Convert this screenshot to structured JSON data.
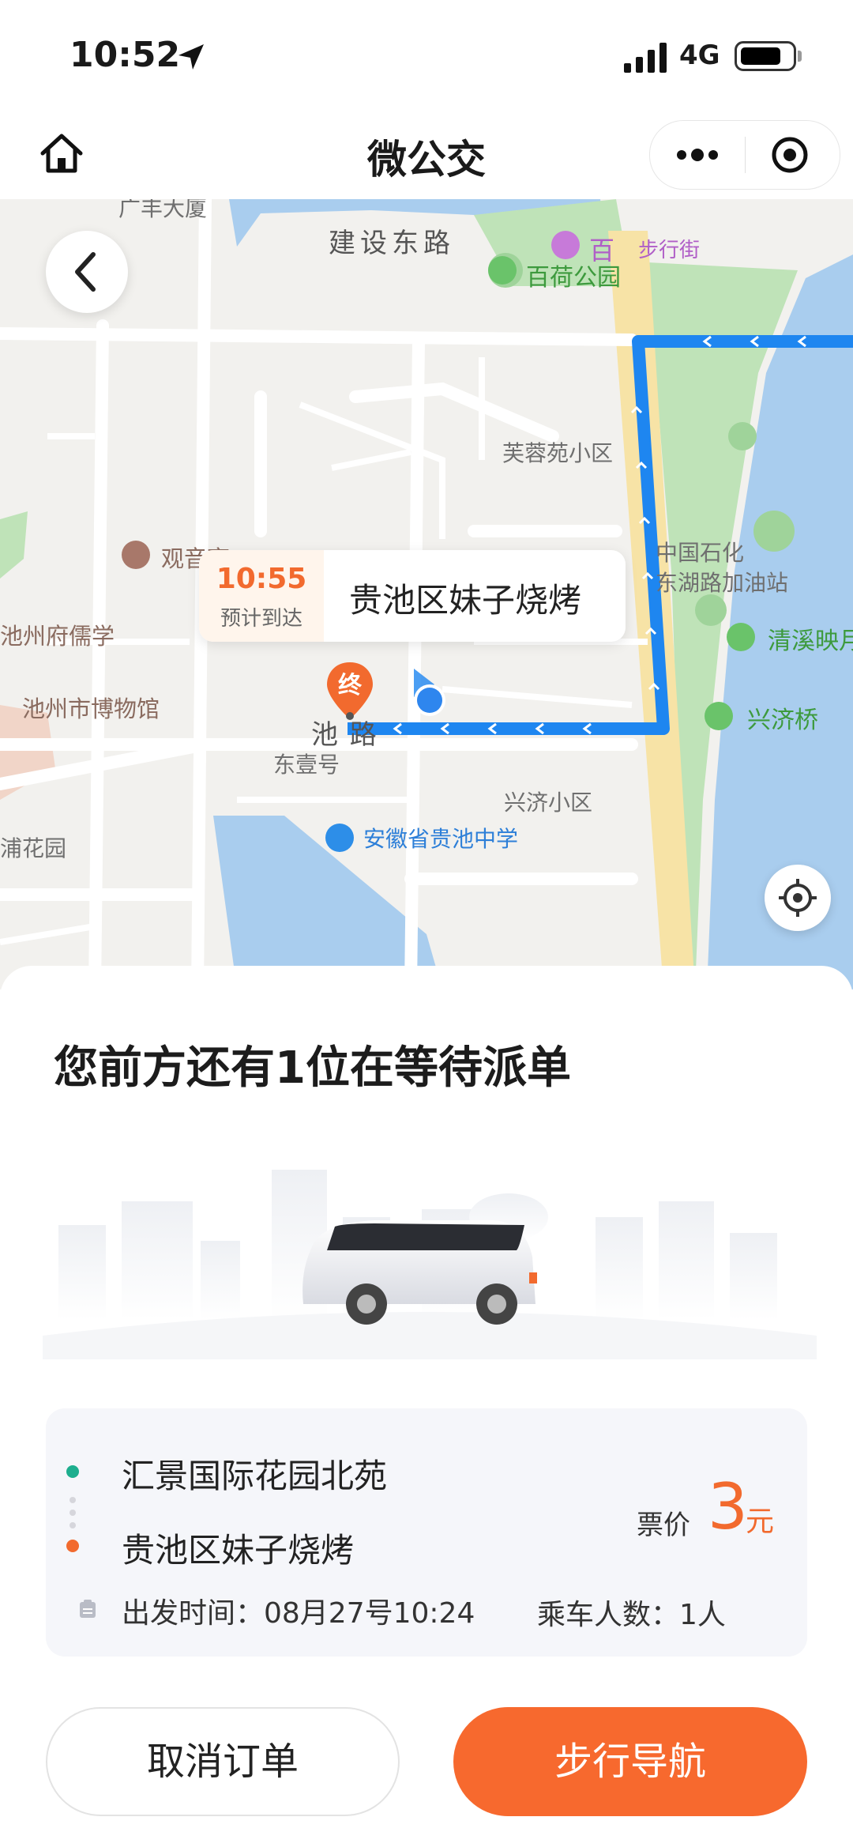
{
  "status_bar": {
    "time": "10:52",
    "network": "4G"
  },
  "header": {
    "title": "微公交"
  },
  "map": {
    "labels": {
      "guangfeng": "广丰大厦",
      "baihe_park": "百荷公园",
      "jianshe_east": "建设东路",
      "bai": "百",
      "walking_street": "步行街",
      "furongyuan": "芙蓉苑小区",
      "guanyin": "观音亭",
      "sinopec": "中国石化",
      "donghu_gas": "东湖路加油站",
      "qingxi": "清溪映月",
      "chizhou_school": "池州府儒学",
      "museum": "池州市博物馆",
      "chi_road": "池    路",
      "xingji_bridge": "兴济桥",
      "dongyihao": "东壹号",
      "xingji_community": "兴济小区",
      "guichi_school": "安徽省贵池中学",
      "puhuayuan": "浦花园"
    },
    "eta": {
      "time": "10:55",
      "sub": "预计到达",
      "destination": "贵池区妹子烧烤"
    },
    "end_pin_label": "终"
  },
  "sheet": {
    "queue_title": "您前方还有1位在等待派单",
    "trip": {
      "from": "汇景国际花园北苑",
      "to": "贵池区妹子烧烤",
      "ticket_label": "票价",
      "ticket_value": "3",
      "ticket_unit": "元",
      "departure": "出发时间：08月27号10:24",
      "passengers": "乘车人数：1人"
    },
    "buttons": {
      "cancel": "取消订单",
      "navigate": "步行导航"
    }
  },
  "colors": {
    "accent": "#f7692e",
    "route": "#1e86f0",
    "from_dot": "#1dae8e",
    "to_dot": "#f26a2e"
  }
}
